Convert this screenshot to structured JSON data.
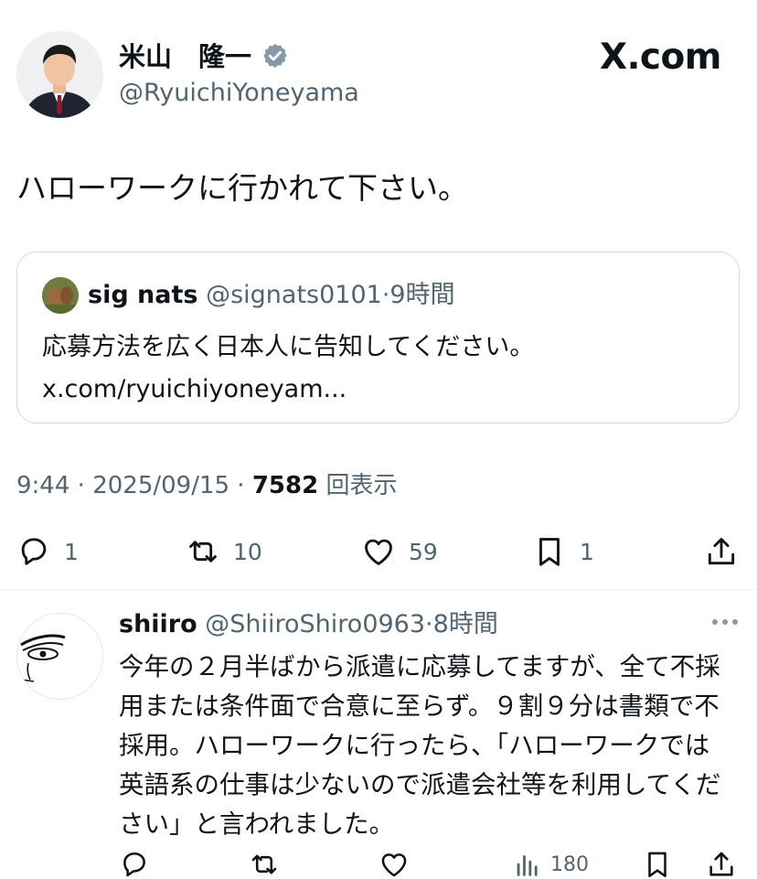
{
  "header": {
    "author_name": "米山　隆一",
    "author_handle": "@RyuichiYoneyama",
    "site_label": "X.com"
  },
  "tweet": {
    "text": "ハローワークに行かれて下さい。",
    "meta": {
      "time": "9:44",
      "date": "2025/09/15",
      "views": "7582",
      "views_label": "回表示"
    }
  },
  "quote": {
    "name": "sig nats",
    "handle": "@signats0101",
    "time": "9時間",
    "text": "応募方法を広く日本人に告知してください。 x.com/ryuichiyoneyam..."
  },
  "actions": {
    "reply_count": "1",
    "repost_count": "10",
    "like_count": "59",
    "bookmark_count": "1"
  },
  "reply": {
    "name": "shiiro",
    "handle": "@ShiiroShiro0963",
    "time": "8時間",
    "text": "今年の２月半ばから派遣に応募してますが、全て不採用または条件面で合意に至らず。９割９分は書類で不採用。ハローワークに行ったら、「ハローワークでは英語系の仕事は少ないので派遣会社等を利用してください」と言われました。",
    "views_count": "180"
  },
  "colors": {
    "text_primary": "#0f1419",
    "text_secondary": "#536471",
    "verified_badge": "#829aab",
    "border": "#cfd9de"
  }
}
